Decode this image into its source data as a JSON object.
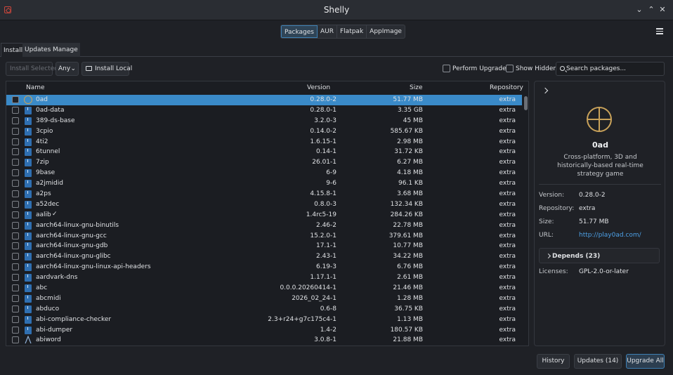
{
  "window": {
    "title": "Shelly"
  },
  "switcher": [
    "Packages",
    "AUR",
    "Flatpak",
    "AppImage"
  ],
  "tabs": [
    "Install",
    "Updates",
    "Manage"
  ],
  "toolbar": {
    "install_selected": "Install Selected",
    "filter": "Any",
    "install_local": "Install Local",
    "perform_upgrade": "Perform Upgrade",
    "show_hidden": "Show Hidden",
    "search_placeholder": "Search packages..."
  },
  "columns": {
    "name": "Name",
    "version": "Version",
    "size": "Size",
    "repository": "Repository"
  },
  "packages": [
    {
      "name": "0ad",
      "version": "0.28.0-2",
      "size": "51.77 MB",
      "repo": "extra",
      "icon": "globe-icon",
      "selected": true
    },
    {
      "name": "0ad-data",
      "version": "0.28.0-1",
      "size": "3.35 GB",
      "repo": "extra",
      "icon": "package-icon"
    },
    {
      "name": "389-ds-base",
      "version": "3.2.0-3",
      "size": "45 MB",
      "repo": "extra",
      "icon": "package-icon"
    },
    {
      "name": "3cpio",
      "version": "0.14.0-2",
      "size": "585.67 KB",
      "repo": "extra",
      "icon": "package-icon"
    },
    {
      "name": "4ti2",
      "version": "1.6.15-1",
      "size": "2.98 MB",
      "repo": "extra",
      "icon": "package-icon"
    },
    {
      "name": "6tunnel",
      "version": "0.14-1",
      "size": "31.72 KB",
      "repo": "extra",
      "icon": "package-icon"
    },
    {
      "name": "7zip",
      "version": "26.01-1",
      "size": "6.27 MB",
      "repo": "extra",
      "icon": "package-icon"
    },
    {
      "name": "9base",
      "version": "6-9",
      "size": "4.18 MB",
      "repo": "extra",
      "icon": "package-icon"
    },
    {
      "name": "a2jmidid",
      "version": "9-6",
      "size": "96.1 KB",
      "repo": "extra",
      "icon": "package-icon"
    },
    {
      "name": "a2ps",
      "version": "4.15.8-1",
      "size": "3.68 MB",
      "repo": "extra",
      "icon": "package-icon"
    },
    {
      "name": "a52dec",
      "version": "0.8.0-3",
      "size": "132.34 KB",
      "repo": "extra",
      "icon": "package-icon"
    },
    {
      "name": "aalib",
      "version": "1.4rc5-19",
      "size": "284.26 KB",
      "repo": "extra",
      "icon": "package-icon",
      "installed": true
    },
    {
      "name": "aarch64-linux-gnu-binutils",
      "version": "2.46-2",
      "size": "22.78 MB",
      "repo": "extra",
      "icon": "package-icon"
    },
    {
      "name": "aarch64-linux-gnu-gcc",
      "version": "15.2.0-1",
      "size": "379.61 MB",
      "repo": "extra",
      "icon": "package-icon"
    },
    {
      "name": "aarch64-linux-gnu-gdb",
      "version": "17.1-1",
      "size": "10.77 MB",
      "repo": "extra",
      "icon": "package-icon"
    },
    {
      "name": "aarch64-linux-gnu-glibc",
      "version": "2.43-1",
      "size": "34.22 MB",
      "repo": "extra",
      "icon": "package-icon"
    },
    {
      "name": "aarch64-linux-gnu-linux-api-headers",
      "version": "6.19-3",
      "size": "6.76 MB",
      "repo": "extra",
      "icon": "package-icon"
    },
    {
      "name": "aardvark-dns",
      "version": "1.17.1-1",
      "size": "2.61 MB",
      "repo": "extra",
      "icon": "package-icon"
    },
    {
      "name": "abc",
      "version": "0.0.0.20260414-1",
      "size": "21.46 MB",
      "repo": "extra",
      "icon": "package-icon"
    },
    {
      "name": "abcmidi",
      "version": "2026_02_24-1",
      "size": "1.28 MB",
      "repo": "extra",
      "icon": "package-icon"
    },
    {
      "name": "abduco",
      "version": "0.6-8",
      "size": "36.75 KB",
      "repo": "extra",
      "icon": "package-icon"
    },
    {
      "name": "abi-compliance-checker",
      "version": "2.3+r24+g7c175c4-1",
      "size": "1.13 MB",
      "repo": "extra",
      "icon": "package-icon"
    },
    {
      "name": "abi-dumper",
      "version": "1.4-2",
      "size": "180.57 KB",
      "repo": "extra",
      "icon": "package-icon"
    },
    {
      "name": "abiword",
      "version": "3.0.8-1",
      "size": "21.88 MB",
      "repo": "extra",
      "icon": "abiword-icon"
    }
  ],
  "detail": {
    "name": "0ad",
    "description": "Cross-platform, 3D and historically-based real-time strategy game",
    "version_label": "Version:",
    "version": "0.28.0-2",
    "repository_label": "Repository:",
    "repository": "extra",
    "size_label": "Size:",
    "size": "51.77 MB",
    "url_label": "URL:",
    "url": "http://play0ad.com/",
    "depends": "Depends (23)",
    "licenses_label": "Licenses:",
    "licenses": "GPL-2.0-or-later"
  },
  "footer": {
    "history": "History",
    "updates": "Updates (14)",
    "upgrade_all": "Upgrade All"
  },
  "colors": {
    "accent": "#3a8ac8",
    "link": "#4da0e6",
    "app_icon": "#c8463c"
  }
}
